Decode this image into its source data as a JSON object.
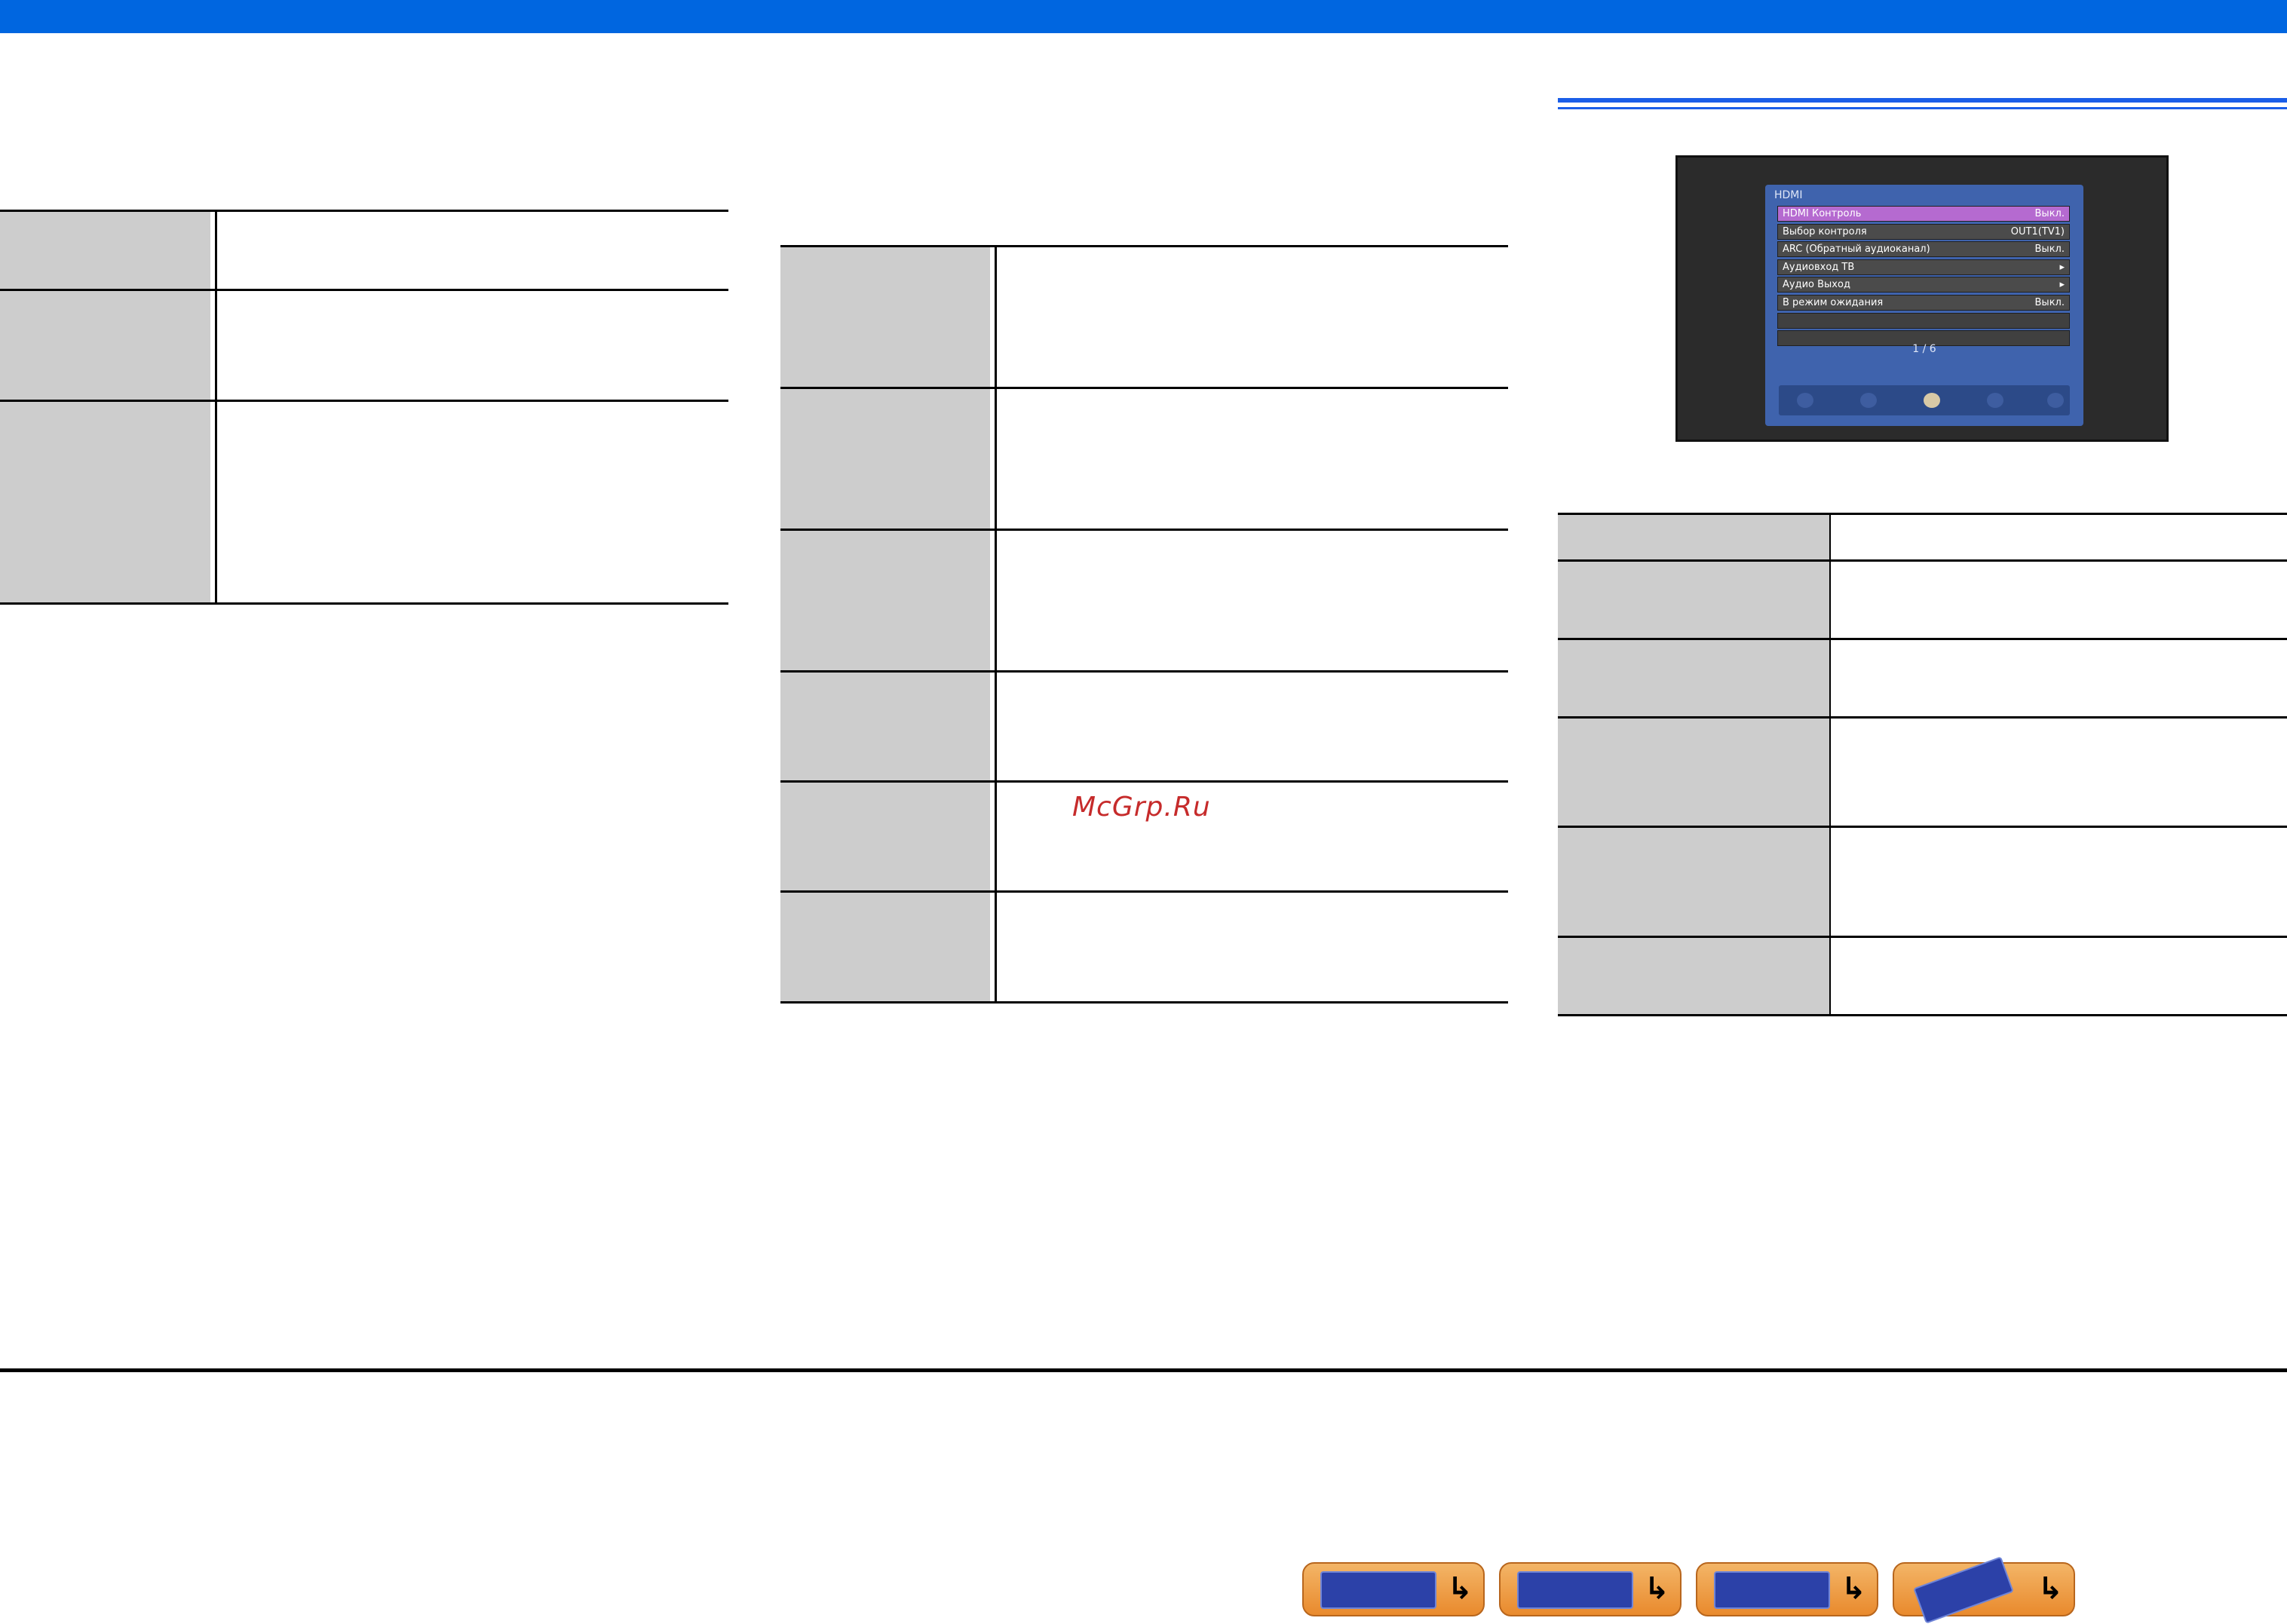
{
  "watermark": "McGrp.Ru",
  "osd": {
    "title": "HDMI",
    "items": [
      {
        "label": "HDMI Контроль",
        "value": "Выкл."
      },
      {
        "label": "Выбор контроля",
        "value": "OUT1(TV1)"
      },
      {
        "label": "ARC (Обратный аудиоканал)",
        "value": "Выкл."
      },
      {
        "label": "Аудиовход ТВ",
        "value": "▸"
      },
      {
        "label": "Аудио Выход",
        "value": "▸"
      },
      {
        "label": "В режим ожидания",
        "value": "Выкл."
      }
    ],
    "page": "1 / 6"
  },
  "nav_buttons": [
    {
      "name": "front-panel-icon",
      "arrow": "↳"
    },
    {
      "name": "rear-panel-icon",
      "arrow": "↳"
    },
    {
      "name": "display-icon",
      "arrow": "↳"
    },
    {
      "name": "remote-control-icon",
      "arrow": "↳"
    }
  ]
}
